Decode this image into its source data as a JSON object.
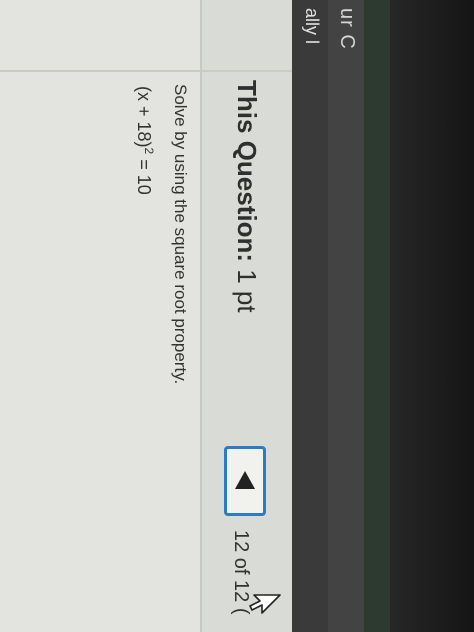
{
  "sidebar": {
    "text_top": "ur C",
    "text_bottom": "ally l"
  },
  "header": {
    "title_bold": "This Question:",
    "title_points": "1 pt",
    "page_indicator": "12 of 12 ("
  },
  "question": {
    "prompt": "Solve by using the square root property.",
    "equation_left": "(x + 18)",
    "equation_exponent": "2",
    "equation_right": " = 10"
  },
  "icons": {
    "prev": "left-triangle-icon",
    "cursor": "mouse-pointer-icon"
  },
  "colors": {
    "accent": "#2b7cc4",
    "background": "#e3e4e0"
  }
}
